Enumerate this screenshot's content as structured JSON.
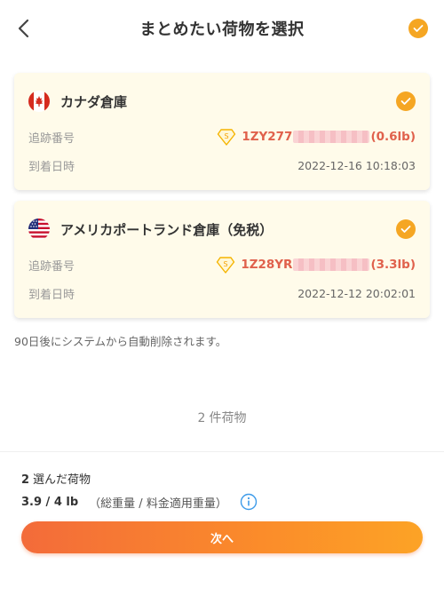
{
  "header": {
    "title": "まとめたい荷物を選択"
  },
  "packages": [
    {
      "warehouse": "カナダ倉庫",
      "flag_icon": "canada-flag-icon",
      "tracking_label": "追跡番号",
      "tracking_prefix": "1ZY277",
      "weight": "(0.6lb)",
      "arrival_label": "到着日時",
      "arrival_time": "2022-12-16 10:18:03"
    },
    {
      "warehouse": "アメリカポートランド倉庫（免税）",
      "flag_icon": "usa-flag-icon",
      "tracking_label": "追跡番号",
      "tracking_prefix": "1Z28YR",
      "weight": "(3.3lb)",
      "arrival_label": "到着日時",
      "arrival_time": "2022-12-12 20:02:01"
    }
  ],
  "notice": "90日後にシステムから自動削除されます。",
  "summary": {
    "count": "2",
    "count_label": "件荷物"
  },
  "footer": {
    "selected_count": "2",
    "selected_label": "選んだ荷物",
    "weight_value": "3.9 / 4 lb",
    "weight_label": "（総重量 / 料金適用重量）",
    "next_label": "次へ"
  },
  "colors": {
    "accent": "#f5a623",
    "tracking": "#e0614c",
    "card_bg": "#fffbea",
    "button_start": "#f36b3a",
    "button_end": "#fca326"
  }
}
